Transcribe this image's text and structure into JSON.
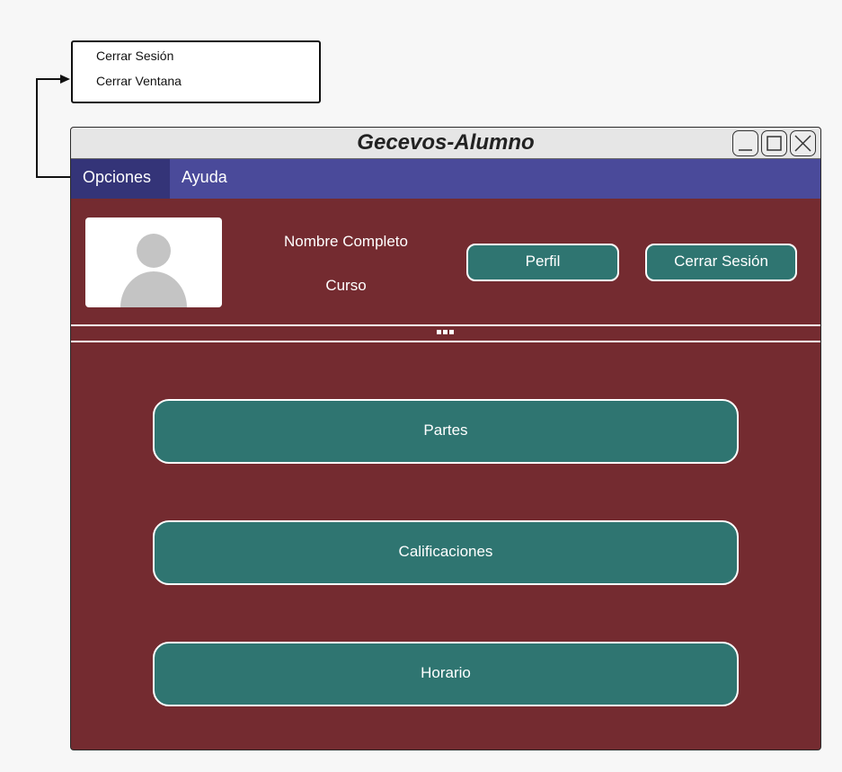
{
  "popup_menu": {
    "items": [
      {
        "label": "Cerrar Sesión"
      },
      {
        "label": "Cerrar Ventana"
      }
    ]
  },
  "window": {
    "title": "Gecevos-Alumno",
    "controls": [
      "minimize-icon",
      "maximize-icon",
      "close-icon"
    ]
  },
  "menubar": {
    "items": [
      {
        "label": "Opciones",
        "active": true
      },
      {
        "label": "Ayuda",
        "active": false
      }
    ]
  },
  "profile": {
    "full_name": "Nombre Completo",
    "course": "Curso",
    "avatar_icon": "user-silhouette-icon",
    "profile_button": "Perfil",
    "logout_button": "Cerrar Sesión"
  },
  "actions": [
    {
      "label": "Partes"
    },
    {
      "label": "Calificaciones"
    },
    {
      "label": "Horario"
    }
  ],
  "colors": {
    "window_bg": "#742b30",
    "menubar": "#4a4a9a",
    "menubar_active": "#343478",
    "button": "#2f7571",
    "titlebar": "#e6e6e6"
  }
}
